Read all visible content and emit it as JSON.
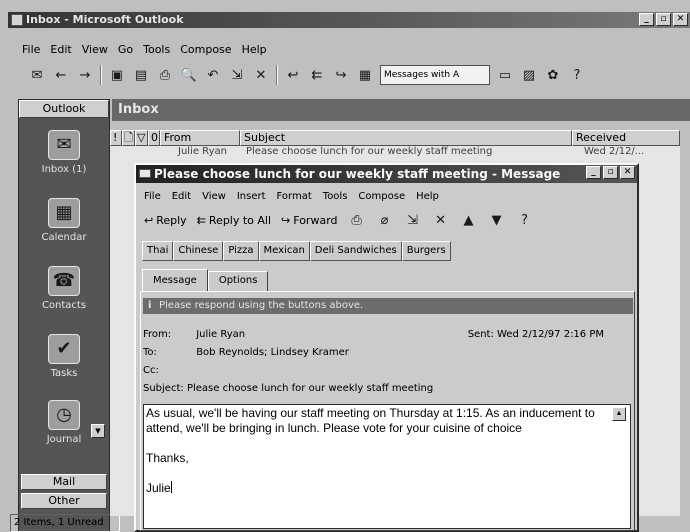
{
  "app": {
    "title": "Inbox - Microsoft Outlook",
    "window_buttons": [
      "_",
      "▫",
      "✕"
    ]
  },
  "menu": [
    "File",
    "Edit",
    "View",
    "Go",
    "Tools",
    "Compose",
    "Help"
  ],
  "toolbar": {
    "view_combo": "Messages with A"
  },
  "outlook_bar": {
    "header": "Outlook",
    "items": [
      "Inbox (1)",
      "Calendar",
      "Contacts",
      "Tasks",
      "Journal"
    ],
    "group_mail": "Mail",
    "group_other": "Other"
  },
  "status_bar": "2 Items, 1 Unread",
  "folder": {
    "title": "Inbox"
  },
  "list": {
    "columns": [
      "!",
      "🗋",
      "▽",
      "0",
      "From",
      "Subject",
      "Received"
    ],
    "row": {
      "from": "Julie Ryan",
      "subject": "Please choose lunch for our weekly staff meeting",
      "received": "Wed 2/12/..."
    }
  },
  "message": {
    "title": "Please choose lunch for our weekly staff meeting - Message",
    "menu": [
      "File",
      "Edit",
      "View",
      "Insert",
      "Format",
      "Tools",
      "Compose",
      "Help"
    ],
    "toolbar": {
      "reply": "Reply",
      "reply_all": "Reply to All",
      "forward": "Forward"
    },
    "vote_buttons": [
      "Thai",
      "Chinese",
      "Pizza",
      "Mexican",
      "Deli Sandwiches",
      "Burgers"
    ],
    "tabs": [
      "Message",
      "Options"
    ],
    "info": "Please respond using the buttons above.",
    "from_label": "From:",
    "from": "Julie Ryan",
    "sent": "Sent: Wed 2/12/97 2:16 PM",
    "to_label": "To:",
    "to": "Bob Reynolds; Lindsey Kramer",
    "cc_label": "Cc:",
    "subject_label": "Subject:",
    "subject": "Please choose lunch for our weekly staff meeting",
    "body": [
      "As usual, we'll be having our staff meeting on Thursday at 1:15. As an inducement to attend, we'll be bringing in lunch. Please vote for your cuisine of choice",
      "Thanks,",
      "Julie"
    ]
  }
}
